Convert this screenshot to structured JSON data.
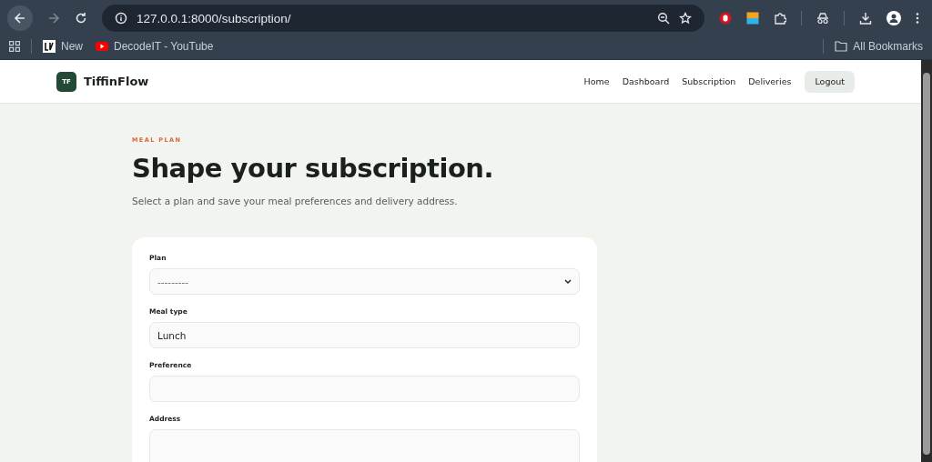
{
  "browser": {
    "url": "127.0.0.1:8000/subscription/",
    "bookmarks": [
      {
        "label": "New",
        "kind": "site"
      },
      {
        "label": "DecodeIT - YouTube",
        "kind": "video"
      }
    ],
    "all_bookmarks": "All Bookmarks"
  },
  "header": {
    "brand_mark": "TF",
    "brand": "TiffinFlow",
    "nav": [
      {
        "label": "Home"
      },
      {
        "label": "Dashboard"
      },
      {
        "label": "Subscription"
      },
      {
        "label": "Deliveries"
      }
    ],
    "logout": "Logout"
  },
  "hero": {
    "eyebrow": "MEAL PLAN",
    "title": "Shape your subscription.",
    "subtitle": "Select a plan and save your meal preferences and delivery address."
  },
  "form": {
    "fields": [
      {
        "label": "Plan",
        "kind": "select",
        "value": "---------"
      },
      {
        "label": "Meal type",
        "kind": "input",
        "value": "Lunch"
      },
      {
        "label": "Preference",
        "kind": "input"
      },
      {
        "label": "Address",
        "kind": "textarea"
      }
    ]
  }
}
